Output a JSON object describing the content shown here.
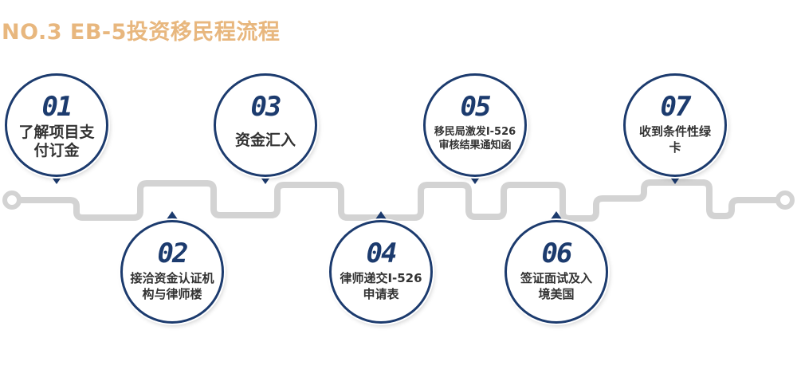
{
  "title": "NO.3  EB-5投资移民程流程",
  "colors": {
    "accent": "#1c3b6e",
    "title": "#e8b77e",
    "track": "#d3d3d3"
  },
  "steps": [
    {
      "num": "01",
      "label": "了解项目支付订金"
    },
    {
      "num": "02",
      "label": "接洽资金认证机构与律师楼"
    },
    {
      "num": "03",
      "label": "资金汇入"
    },
    {
      "num": "04",
      "label": "律师递交I-526申请表"
    },
    {
      "num": "05",
      "label": "移民局激发I-526审核结果通知函"
    },
    {
      "num": "06",
      "label": "签证面试及入境美国"
    },
    {
      "num": "07",
      "label": "收到条件性绿卡"
    }
  ]
}
